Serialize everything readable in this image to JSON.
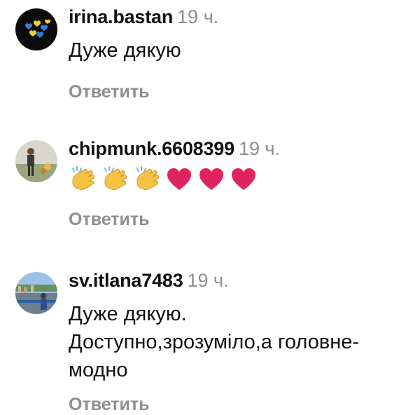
{
  "comments": [
    {
      "username": "irina.bastan",
      "time": "19 ч.",
      "text": "Дуже дякую",
      "reply_label": "Ответить",
      "avatar_icon": "blue-yellow-hearts-avatar"
    },
    {
      "username": "chipmunk.6608399",
      "time": "19 ч.",
      "emojis": [
        "clapping-hands-icon",
        "clapping-hands-icon",
        "clapping-hands-icon",
        "red-heart-icon",
        "red-heart-icon",
        "red-heart-icon"
      ],
      "reply_label": "Ответить",
      "avatar_icon": "person-photo-avatar"
    },
    {
      "username": "sv.itlana7483",
      "time": "19 ч.",
      "text": "Дуже дякую.\nДоступно,зрозуміло,а головне-\nмодно",
      "reply_label": "Ответить",
      "avatar_icon": "city-photo-avatar"
    }
  ],
  "colors": {
    "username": "#111111",
    "time": "#8e8e8e",
    "reply": "#8e8e8e",
    "heart": "#e0245e",
    "clap": "#f6c244"
  }
}
